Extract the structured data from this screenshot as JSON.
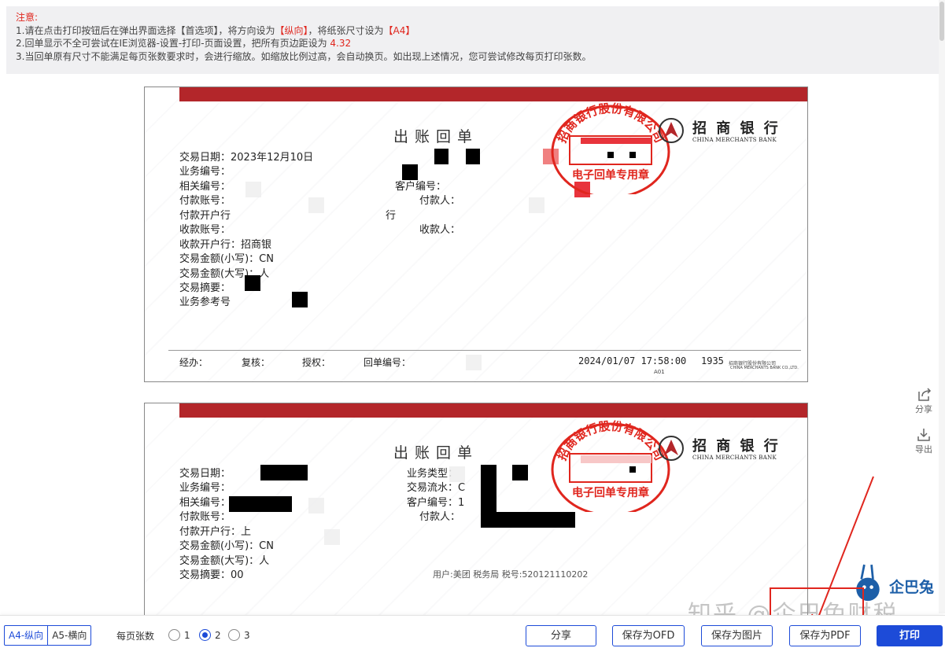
{
  "notice": {
    "title": "注意:",
    "line1_a": "1.请在点击打印按钮后在弹出界面选择【首选项】，将方向设为",
    "line1_b": "【纵向】",
    "line1_c": "，将纸张尺寸设为",
    "line1_d": "【A4】",
    "line2_a": "2.回单显示不全可尝试在IE浏览器-设置-打印-页面设置，把所有页边距设为",
    "line2_b": "4.32",
    "line3": "3.当回单原有尺寸不能满足每页张数要求时，会进行缩放。如缩放比例过高，会自动换页。如出现上述情况，您可尝试修改每页打印张数。"
  },
  "receipt1": {
    "title": "出账回单",
    "date": "交易日期：2023年12月10日",
    "biz_no": "业务编号：",
    "rel_no": "相关编号：",
    "pay_acct": "付款账号：",
    "pay_bank": "付款开户行",
    "pay_bank_tail": "行",
    "recv_acct": "收款账号：",
    "recv_bank": "收款开户行：招商银",
    "amt_small": "交易金额(小写)：CN",
    "amt_big": "交易金额(大写)：人",
    "summary": "交易摘要：",
    "ref": "业务参考号",
    "cust_no": "客户编号：",
    "payer": "付款人：",
    "payee": "收款人：",
    "seal_top": "招商银行股份有限公司",
    "seal_bottom": "电子回单专用章",
    "bank_cn": "招 商 银 行",
    "bank_en": "CHINA MERCHANTS BANK",
    "footer_handle": "经办：",
    "footer_review": "复核：",
    "footer_auth": "授权：",
    "footer_no": "回单编号：",
    "footer_time": "2024/01/07 17:58:00",
    "footer_code": "1935",
    "footer_tiny_cn": "招商银行股份有限公司",
    "footer_tiny_en": "CHINA MERCHANTS BANK CO.,LTD.",
    "footer_a01": "A01"
  },
  "receipt2": {
    "title": "出账回单",
    "date": "交易日期：",
    "biz_no": "业务编号：",
    "rel_no": "相关编号：",
    "pay_acct": "付款账号：",
    "pay_bank": "付款开户行：上",
    "amt_small": "交易金额(小写)：CN",
    "amt_big": "交易金额(大写)：人",
    "summary": "交易摘要：00",
    "biz_type": "业务类型：",
    "serial": "交易流水：C",
    "cust_no": "客户编号：1",
    "payer": "付款人：",
    "note": "用户:美团 税务局 税号:520121110202",
    "seal_top": "招商银行股份有限公司",
    "seal_bottom": "电子回单专用章",
    "bank_cn": "招 商 银 行",
    "bank_en": "CHINA MERCHANTS BANK"
  },
  "side": {
    "share": "分享",
    "export": "导出"
  },
  "watermark": "知乎 @企巴兔财税",
  "brand": "企巴兔",
  "bottom": {
    "orient_a4": "A4-纵向",
    "orient_a5": "A5-横向",
    "per_page": "每页张数",
    "opt1": "1",
    "opt2": "2",
    "opt3": "3",
    "share": "分享",
    "save_ofd": "保存为OFD",
    "save_img": "保存为图片",
    "save_pdf": "保存为PDF",
    "print": "打印"
  },
  "colors": {
    "accent": "#1d4bd8",
    "bank_red": "#b3262a",
    "seal_red": "#e0261e"
  }
}
